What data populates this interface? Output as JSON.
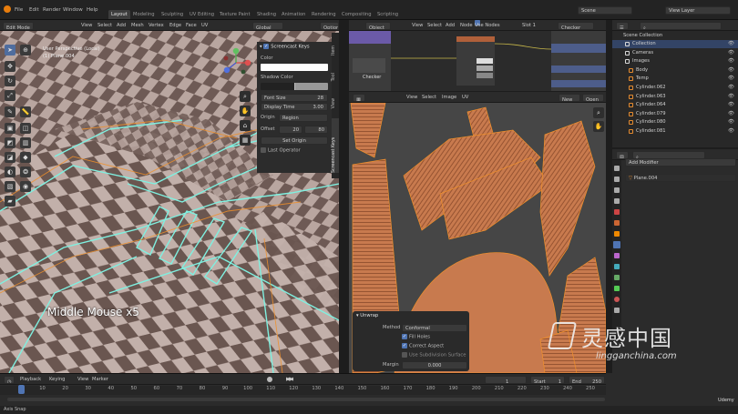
{
  "topbar": {
    "menus": [
      "File",
      "Edit",
      "Render",
      "Window",
      "Help"
    ],
    "workspaces": [
      "Layout",
      "Modeling",
      "Sculpting",
      "UV Editing",
      "Texture Paint",
      "Shading",
      "Animation",
      "Rendering",
      "Compositing",
      "Scripting"
    ],
    "active_workspace": "Layout",
    "scene": "Scene",
    "view_layer": "View Layer"
  },
  "viewport": {
    "mode": "Edit Mode",
    "menus": [
      "View",
      "Select",
      "Add",
      "Mesh",
      "Vertex",
      "Edge",
      "Face",
      "UV"
    ],
    "orientation": "Global",
    "options": "Options",
    "info_line1": "User Perspective (Local)",
    "info_line2": "(1) Plane.004",
    "overlay_text": "Middle Mouse x5"
  },
  "screencast_panel": {
    "title": "Screencast Keys",
    "color_label": "Color",
    "shadow_color_label": "Shadow Color",
    "font_size_label": "Font Size",
    "font_size_value": "28",
    "display_time_label": "Display Time",
    "display_time_value": "3.00",
    "origin_label": "Origin",
    "origin_value": "Region",
    "offset_label": "Offset",
    "offset_x": "20",
    "offset_y": "80",
    "set_origin_label": "Set Origin",
    "last_operator_label": "Last Operator",
    "side_tabs": [
      "Item",
      "Tool",
      "View",
      "Screencast Keys"
    ]
  },
  "node_editor": {
    "header": [
      "Object",
      "View",
      "Select",
      "Add",
      "Node"
    ],
    "use_nodes_label": "Use Nodes",
    "slot": "Slot 1",
    "material": "Checker",
    "texture_label": "Checker"
  },
  "uv_editor": {
    "menus": [
      "View",
      "Select",
      "Image",
      "UV"
    ],
    "new_label": "New",
    "open_label": "Open"
  },
  "unwrap_panel": {
    "title": "Unwrap",
    "method_label": "Method",
    "method_value": "Conformal",
    "fill_holes_label": "Fill Holes",
    "correct_aspect_label": "Correct Aspect",
    "subsurf_label": "Use Subdivision Surface",
    "margin_label": "Margin",
    "margin_value": "0.000"
  },
  "outliner": {
    "title": "Scene Collection",
    "items": [
      {
        "name": "Collection",
        "color": "#d8d8d8"
      },
      {
        "name": "Cameras",
        "color": "#d8d8d8"
      },
      {
        "name": "Images",
        "color": "#d8d8d8"
      },
      {
        "name": "Body",
        "color": "#e38a2f"
      },
      {
        "name": "Temp",
        "color": "#e38a2f"
      },
      {
        "name": "Cylinder.062",
        "color": "#e38a2f"
      },
      {
        "name": "Cylinder.063",
        "color": "#e38a2f"
      },
      {
        "name": "Cylinder.064",
        "color": "#e38a2f"
      },
      {
        "name": "Cylinder.079",
        "color": "#e38a2f"
      },
      {
        "name": "Cylinder.080",
        "color": "#e38a2f"
      },
      {
        "name": "Cylinder.081",
        "color": "#e38a2f"
      }
    ]
  },
  "properties": {
    "add_modifier_label": "Add Modifier",
    "object_name": "Plane.004"
  },
  "timeline": {
    "menus": [
      "Playback",
      "Keying",
      "View",
      "Marker"
    ],
    "current_frame": "1",
    "start_label": "Start",
    "start_value": "1",
    "end_label": "End",
    "end_value": "250",
    "ruler": [
      "1",
      "10",
      "20",
      "30",
      "40",
      "50",
      "60",
      "70",
      "80",
      "90",
      "100",
      "110",
      "120",
      "130",
      "140",
      "150",
      "160",
      "170",
      "180",
      "190",
      "200",
      "210",
      "220",
      "230",
      "240",
      "250"
    ]
  },
  "statusbar": {
    "left": "Axis Snap",
    "watermark_brand": "灵感中国",
    "watermark_url": "lingganchina.com",
    "udemy": "Udemy"
  },
  "colors": {
    "accent_blue": "#4f74b3",
    "uv_orange": "#c87a4e",
    "wire_teal": "#7ff0e0",
    "selection_orange": "#f0902a"
  }
}
